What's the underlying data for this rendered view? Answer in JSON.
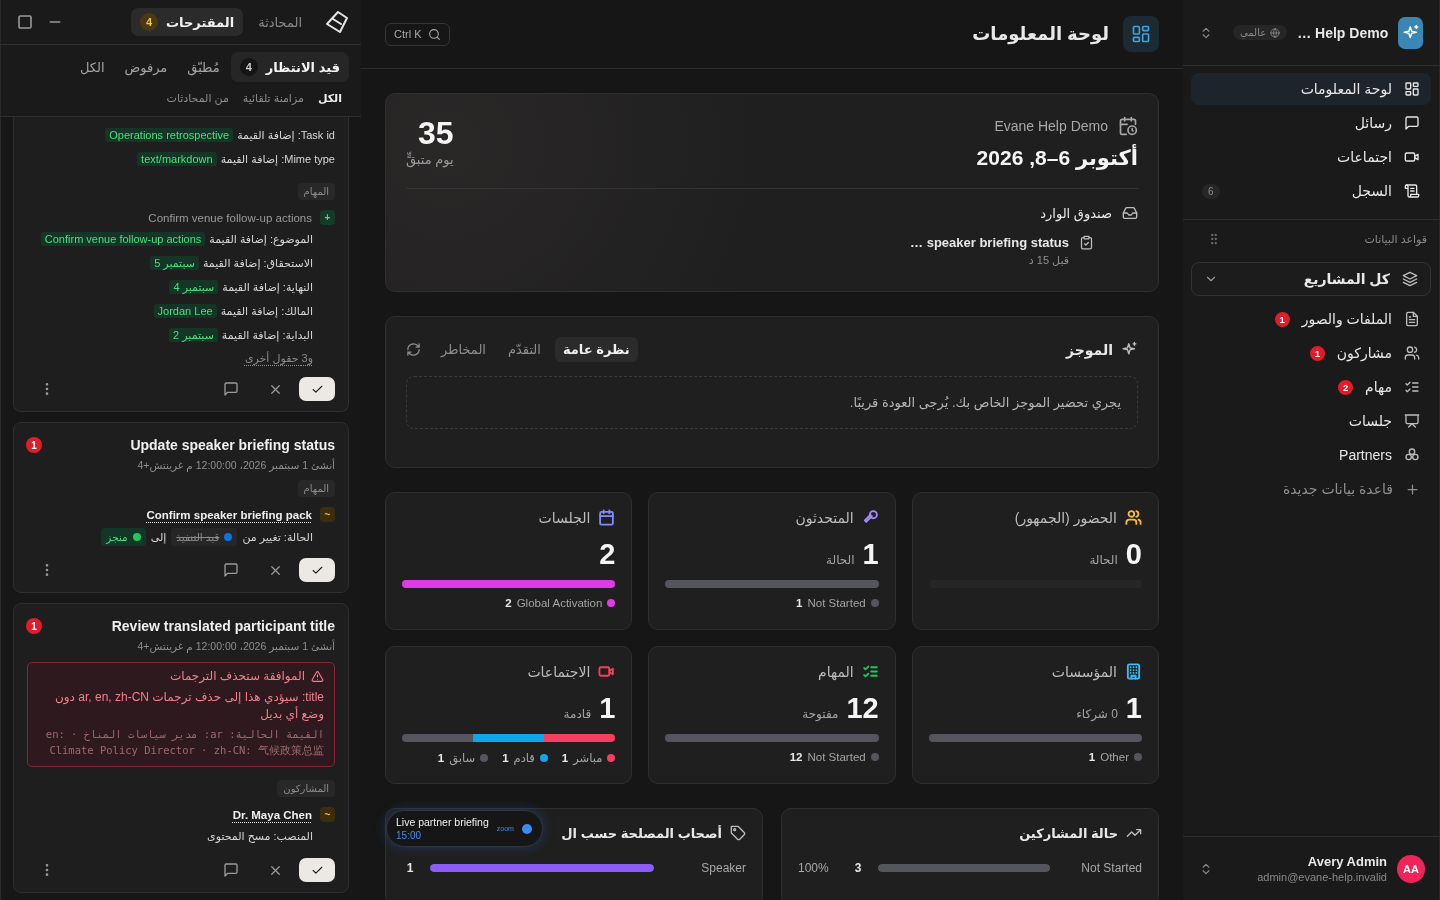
{
  "left_panel": {
    "tabs": [
      {
        "label": "المحادثة",
        "selected": false
      },
      {
        "label": "المقترحات",
        "count": "4",
        "selected": true
      }
    ],
    "status_filters": [
      {
        "label": "قيد الانتظار",
        "count": "4",
        "selected": true
      },
      {
        "label": "مُطبّق",
        "selected": false
      },
      {
        "label": "مرفوض",
        "selected": false
      },
      {
        "label": "الكل",
        "selected": false
      }
    ],
    "source_filters": [
      {
        "label": "الكل",
        "selected": true
      },
      {
        "label": "مزامنة تلقائية",
        "selected": false
      },
      {
        "label": "من المحادثات",
        "selected": false
      }
    ],
    "cards": [
      {
        "fields": [
          {
            "label": "Task id: إضافة القيمة",
            "value": "Operations retrospective"
          },
          {
            "label": "Mime type: إضافة القيمة",
            "value": "text/markdown"
          }
        ],
        "sections": [
          {
            "label": "المهام",
            "items": [
              {
                "mark": "+",
                "kind": "add",
                "title": "Confirm venue follow-up actions",
                "fields": [
                  {
                    "label": "الموضوع: إضافة القيمة",
                    "value": "Confirm venue follow-up actions"
                  },
                  {
                    "label": "الاستحقاق: إضافة القيمة",
                    "value": "سبتمبر 5"
                  },
                  {
                    "label": "النهاية: إضافة القيمة",
                    "value": "سبتمبر 4"
                  },
                  {
                    "label": "المالك: إضافة القيمة",
                    "value": "Jordan Lee"
                  },
                  {
                    "label": "البداية: إضافة القيمة",
                    "value": "سبتمبر 2"
                  }
                ]
              }
            ]
          }
        ],
        "more": "و3 حقول أخرى"
      },
      {
        "alerts": "1",
        "title": "Update speaker briefing status",
        "meta": "أنشئ 1 سبتمبر 2026، 12:00:00 م غرينتش+4",
        "sections": [
          {
            "label": "المهام",
            "items": [
              {
                "mark": "~",
                "kind": "modify",
                "title": "Confirm speaker briefing pack",
                "changes": [
                  {
                    "label": "الحالة: تغيير من",
                    "from": {
                      "text": "قيد التنفيذ",
                      "color": "#0b74de"
                    },
                    "joiner": "إلى",
                    "to": {
                      "text": "منجز",
                      "color": "#22c55e"
                    }
                  }
                ]
              }
            ]
          }
        ]
      },
      {
        "alerts": "1",
        "title": "Review translated participant title",
        "meta": "أنشئ 1 سبتمبر 2026، 12:00:00 م غرينتش+4",
        "warning": {
          "title": "الموافقة ستحذف الترجمات",
          "text": "title: سيؤدي هذا إلى حذف ترجمات ar, en, zh-CN دون وضع أي بديل",
          "detail": "القيمة الحالية: ar: مدير سياسات المناخ · en: Climate Policy Director · zh-CN: 气候政策总监"
        },
        "sections": [
          {
            "label": "المشاركون",
            "items": [
              {
                "mark": "~",
                "kind": "modify",
                "title": "Dr. Maya Chen",
                "fields": [
                  {
                    "label": "المنصب: مسح المحتوى"
                  }
                ]
              }
            ]
          }
        ]
      }
    ]
  },
  "main": {
    "title": "لوحة المعلومات",
    "search": {
      "shortcut": "Ctrl K"
    },
    "event": {
      "name": "Evane Help Demo",
      "dates": "أكتوبر 6–8, 2026",
      "days": "35",
      "days_label": "يوم متبقٍّ",
      "inbox": {
        "label": "صندوق الوارد",
        "items": [
          {
            "title": "speaker briefing status …",
            "time": "قبل 15 د"
          }
        ]
      }
    },
    "digest": {
      "title": "الموجز",
      "tabs": [
        {
          "label": "نظرة عامة",
          "selected": true
        },
        {
          "label": "التقدّم",
          "selected": false
        },
        {
          "label": "المخاطر",
          "selected": false
        }
      ],
      "message": "يجري تحضير الموجز الخاص بك. يُرجى العودة قريبًا."
    },
    "stats": [
      {
        "title": "الحضور (الجمهور)",
        "color": "#f5b942",
        "value": "0",
        "sub": "الحالة"
      },
      {
        "title": "المتحدثون",
        "color": "#a78bfa",
        "value": "1",
        "sub": "الحالة",
        "legend": [
          {
            "label": "Not Started",
            "count": "1",
            "color": "#55555e"
          }
        ]
      },
      {
        "title": "الجلسات",
        "color": "#818cf8",
        "value": "2",
        "legend": [
          {
            "label": "Global Activation",
            "count": "2",
            "color": "#e03ae6"
          }
        ]
      },
      {
        "title": "المؤسسات",
        "color": "#38bdf8",
        "value": "1",
        "sub": "0 شركاء",
        "legend": [
          {
            "label": "Other",
            "count": "1",
            "color": "#55555e"
          }
        ]
      },
      {
        "title": "المهام",
        "color": "#22c55e",
        "value": "12",
        "sub": "مفتوحة",
        "legend": [
          {
            "label": "Not Started",
            "count": "12",
            "color": "#55555e"
          }
        ]
      },
      {
        "title": "الاجتماعات",
        "color": "#f43f5e",
        "value": "1",
        "sub": "قادمة",
        "legend": [
          {
            "label": "مباشر",
            "count": "1",
            "color": "#f43f5e"
          },
          {
            "label": "قادم",
            "count": "1",
            "color": "#0ea5e9"
          },
          {
            "label": "سابق",
            "count": "1",
            "color": "#55555e"
          }
        ]
      }
    ],
    "participant_status": {
      "title": "حالة المشاركين",
      "rows": [
        {
          "label": "Not Started",
          "count": "3",
          "share": "100%",
          "level": 1
        }
      ]
    },
    "stakeholders": {
      "title": "أصحاب المصلحة حسب ال",
      "rows": [
        {
          "label": "Speaker",
          "count": "1",
          "level": 1
        }
      ]
    },
    "live_pill": {
      "title": "Live partner briefing",
      "time": "15:00",
      "provider": "zoom"
    }
  },
  "sidebar": {
    "workspace": "Help Demo …",
    "scope": "عالمي",
    "nav": [
      {
        "label": "لوحة المعلومات",
        "selected": true
      },
      {
        "label": "رسائل",
        "selected": false
      },
      {
        "label": "اجتماعات",
        "selected": false
      },
      {
        "label": "السجل",
        "count": "6",
        "selected": false
      }
    ],
    "databases_label": "قواعد البيانات",
    "project_picker": "كل المشاريع",
    "databases": [
      {
        "label": "الملفات والصور",
        "alerts": "1"
      },
      {
        "label": "مشاركون",
        "alerts": "1"
      },
      {
        "label": "مهام",
        "alerts": "2"
      },
      {
        "label": "جلسات"
      },
      {
        "label": "Partners"
      }
    ],
    "new_database": "قاعدة بيانات جديدة",
    "user": {
      "initials": "AA",
      "name": "Avery Admin",
      "email": "admin@evane-help.invalid"
    }
  }
}
